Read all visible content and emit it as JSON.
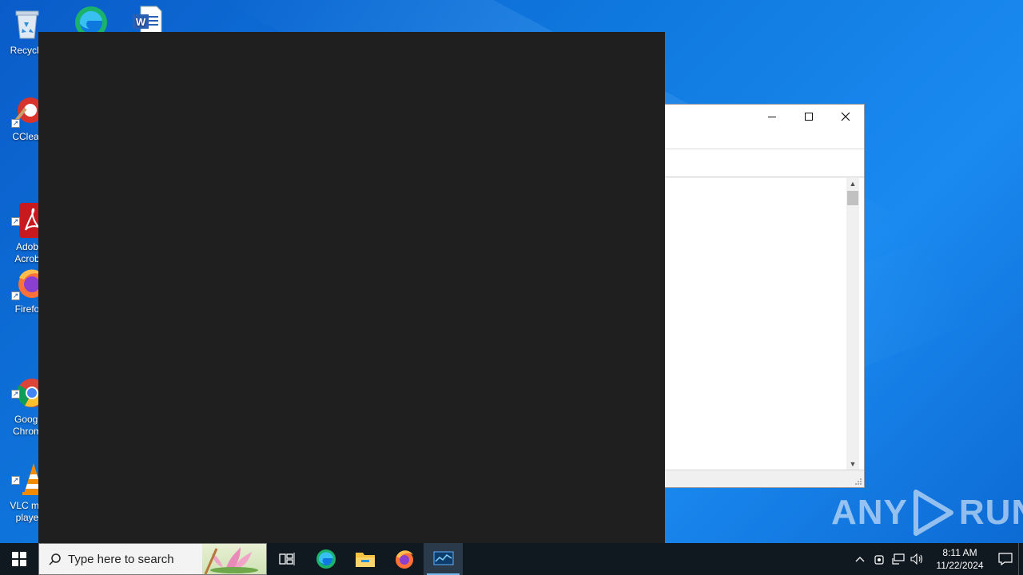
{
  "desktop": {
    "icons": [
      {
        "name": "recycle-bin",
        "label": "Recycle"
      },
      {
        "name": "edge",
        "label": ""
      },
      {
        "name": "word-doc",
        "label": ""
      },
      {
        "name": "ccleaner",
        "label": "CClear"
      },
      {
        "name": "adobe-acrobat",
        "label": "Adob\nAcrob"
      },
      {
        "name": "firefox",
        "label": "Firefo"
      },
      {
        "name": "google-chrome",
        "label": "Googl\nChrom"
      },
      {
        "name": "vlc",
        "label": "VLC me\nplaye"
      }
    ]
  },
  "app_window": {
    "minimize_icon": "minimize-icon",
    "maximize_icon": "maximize-icon",
    "close_icon": "close-icon"
  },
  "watermark": {
    "left": "ANY",
    "right": "RUN"
  },
  "taskbar": {
    "search_placeholder": "Type here to search",
    "clock_time": "8:11 AM",
    "clock_date": "11/22/2024",
    "apps": [
      "task-view",
      "edge",
      "file-explorer",
      "firefox",
      "resource-monitor"
    ]
  },
  "colors": {
    "desktop_accent": "#0f78de",
    "dark_window": "#1f1f1f",
    "taskbar": "#101820"
  }
}
